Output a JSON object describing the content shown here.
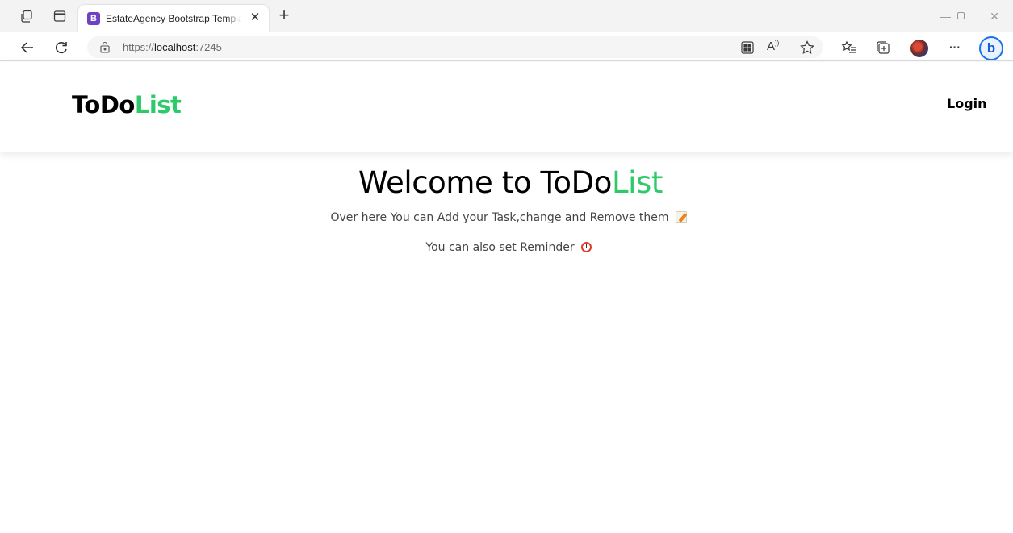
{
  "browser": {
    "tab_title": "EstateAgency Bootstrap Templat",
    "tab_favicon_letter": "B",
    "url_prefix": "https://",
    "url_host": "localhost",
    "url_port": ":7245",
    "more_label": "···",
    "bing_label": "b"
  },
  "header": {
    "brand_part1": "ToDo",
    "brand_part2": "List",
    "login_label": "Login"
  },
  "hero": {
    "title_part1": "Welcome to ToDo",
    "title_part2": "List",
    "line1": "Over here You can Add your Task,change and Remove them",
    "line2": "You can also set Reminder"
  },
  "colors": {
    "accent": "#2eca6a",
    "text": "#000000",
    "muted": "#444444"
  }
}
